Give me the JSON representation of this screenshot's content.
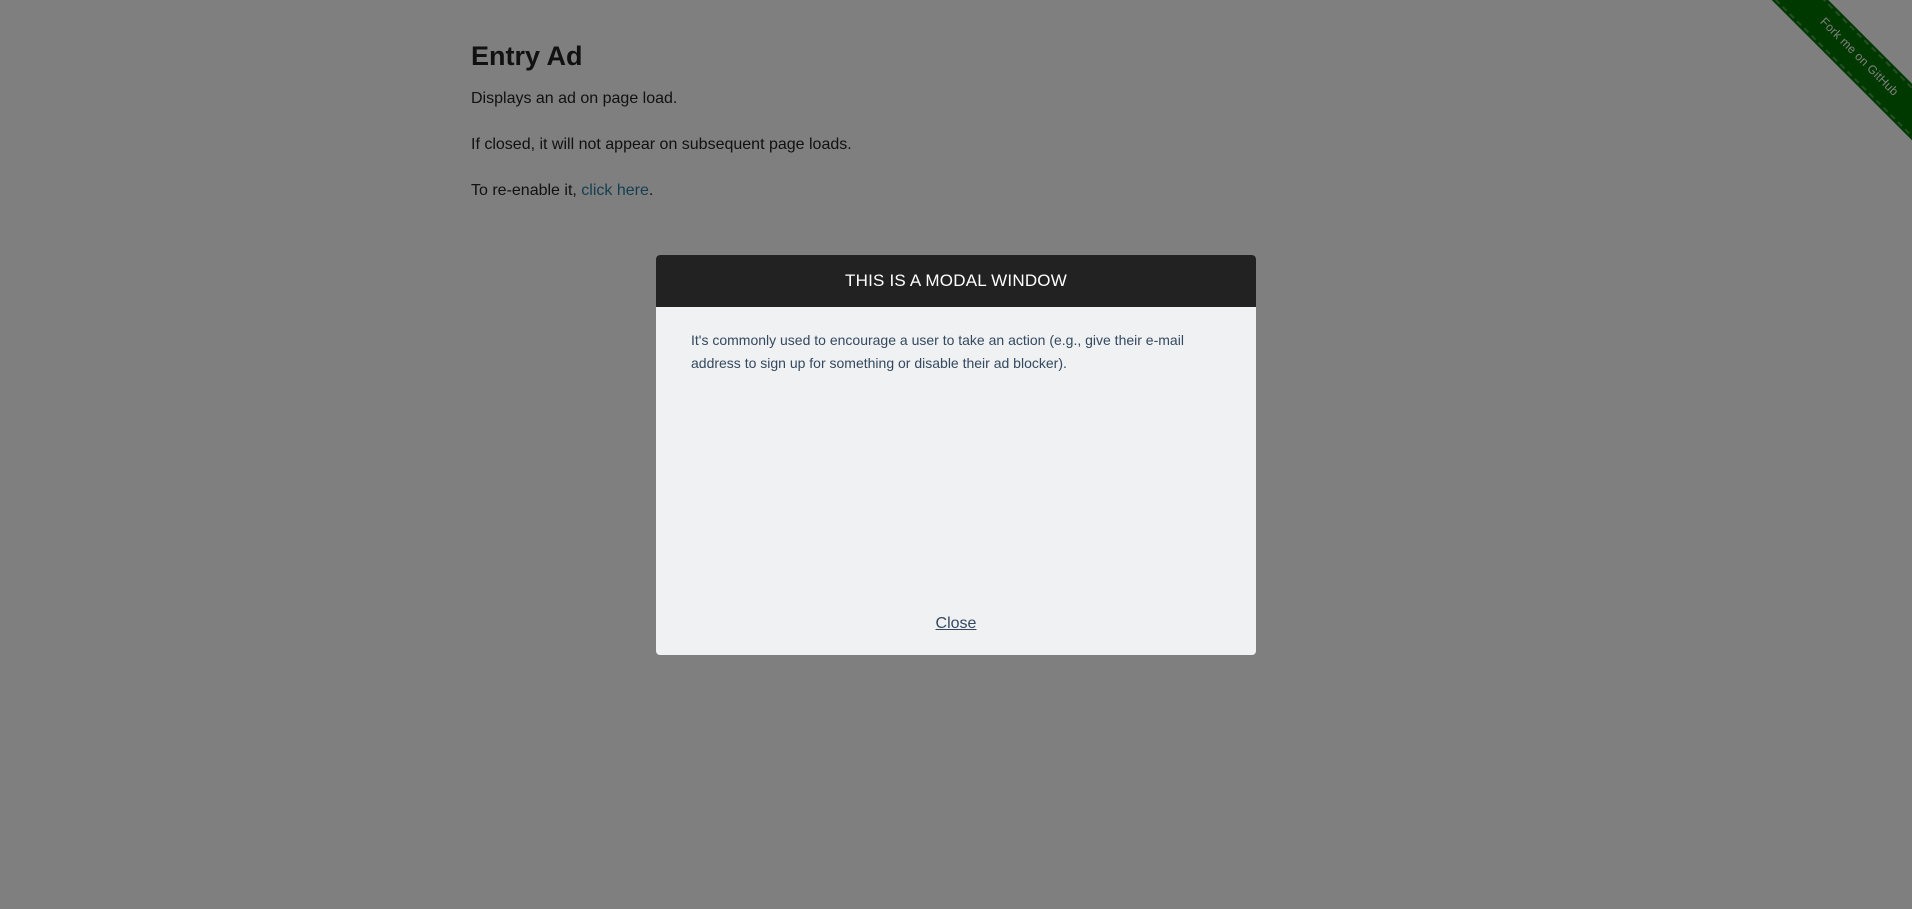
{
  "page": {
    "title": "Entry Ad",
    "paragraph_1": "Displays an ad on page load.",
    "paragraph_2": "If closed, it will not appear on subsequent page loads.",
    "paragraph_3_prefix": "To re-enable it, ",
    "reenable_link": "click here",
    "paragraph_3_suffix": "."
  },
  "fork_ribbon": {
    "label": "Fork me on GitHub"
  },
  "modal": {
    "title": "THIS IS A MODAL WINDOW",
    "body_text": "It's commonly used to encourage a user to take an action (e.g., give their e-mail address to sign up for something or disable their ad blocker).",
    "close_label": "Close"
  },
  "colors": {
    "overlay": "#808080",
    "modal_header": "#222222",
    "modal_body": "#eff1f3",
    "link": "#2a7fa0",
    "ribbon": "#007200"
  }
}
